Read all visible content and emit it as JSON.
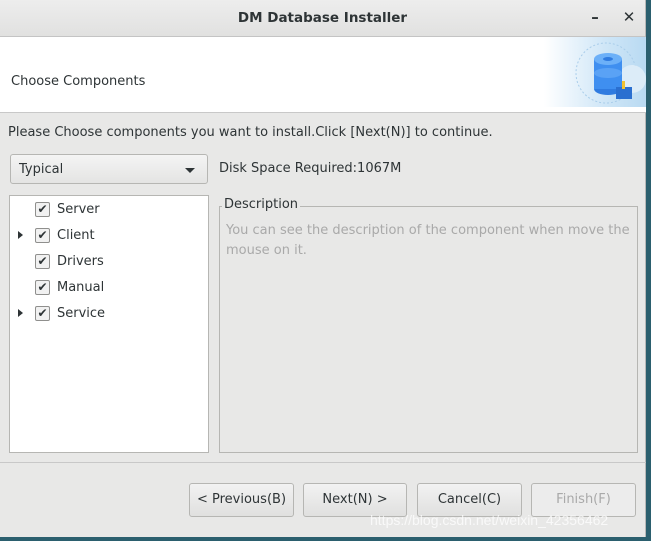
{
  "window": {
    "title": "DM Database Installer",
    "minimize_icon": "minimize-icon",
    "close_icon": "close-icon",
    "minimize": "–",
    "close": "✕"
  },
  "header": {
    "title": "Choose Components",
    "banner_icon": "database-install-icon"
  },
  "intro": "Please Choose components you want to install.Click [Next(N)] to continue.",
  "install_type": {
    "selected": "Typical"
  },
  "disk_space": "Disk Space Required:1067M",
  "components": [
    {
      "label": "Server",
      "checked": true,
      "expandable": false
    },
    {
      "label": "Client",
      "checked": true,
      "expandable": true
    },
    {
      "label": "Drivers",
      "checked": true,
      "expandable": false
    },
    {
      "label": "Manual",
      "checked": true,
      "expandable": false
    },
    {
      "label": "Service",
      "checked": true,
      "expandable": true
    }
  ],
  "description": {
    "title": "Description",
    "text": "You can see the description of the component when move the mouse on it."
  },
  "buttons": {
    "previous": "< Previous(B)",
    "next": "Next(N) >",
    "cancel": "Cancel(C)",
    "finish": "Finish(F)"
  },
  "watermark": "https://blog.csdn.net/weixin_42356462"
}
